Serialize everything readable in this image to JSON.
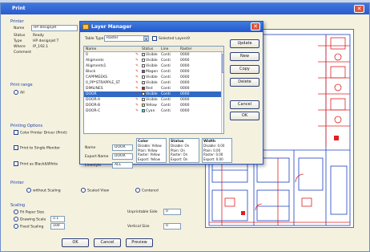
{
  "print_dialog": {
    "title": "Print",
    "close_glyph": "✕",
    "printer_group": "Printer",
    "printer_fields": [
      {
        "label": "Name",
        "value": "HP designjet"
      },
      {
        "label": "Status",
        "value": "Ready"
      },
      {
        "label": "Type",
        "value": "HP designjet T"
      },
      {
        "label": "Where",
        "value": "IP_192.1"
      },
      {
        "label": "Comment",
        "value": ""
      }
    ],
    "print_range_group": "Print range",
    "all_label": "All",
    "printing_options_group": "Printing Options",
    "print_options": [
      "Color Printer Driver (Print)",
      "Print to Single Monitor",
      "Print as Black&White"
    ],
    "printer_group_title": "Printer",
    "layout_options": [
      "without Scaling",
      "Scaled View",
      "Centered"
    ],
    "scaling_group": "Scaling",
    "scaling_options": [
      "Fit Paper Size",
      "Drawing Scale",
      "Fixed Scaling"
    ],
    "scaling_values": [
      "1:1",
      "100"
    ],
    "unprintable_label": "Unprintable Side",
    "vertical_label": "Vertical Size",
    "unprintable_value": "0",
    "vertical_value": "0",
    "buttons": {
      "ok": "OK",
      "cancel": "Cancel",
      "preview": "Preview"
    }
  },
  "layer_manager": {
    "title": "Layer Manager",
    "close_glyph": "✕",
    "table_type_label": "Table Type",
    "table_type_value": "Raster",
    "selected_layers_label": "Selected Layers",
    "selected_layers_value": "9",
    "columns": [
      "Name",
      "Status",
      "Line",
      "Raster"
    ],
    "rows": [
      {
        "name": "0",
        "vis": "Visible",
        "line": "Conti",
        "raster": "0000",
        "swatch": "#ffffff"
      },
      {
        "name": "Aligments",
        "vis": "Visible",
        "line": "Conti",
        "raster": "0000",
        "swatch": "#ffffff"
      },
      {
        "name": "Aligments1",
        "vis": "Visible",
        "line": "Conti",
        "raster": "0000",
        "swatch": "#ffffff"
      },
      {
        "name": "Block",
        "vis": "Magen",
        "line": "Conti",
        "raster": "0000",
        "swatch": "#ff00ff"
      },
      {
        "name": "CAPPMEEKS",
        "vis": "Visible",
        "line": "Conti",
        "raster": "0000",
        "swatch": "#ffffff"
      },
      {
        "name": "0_PP*STRAPPLE_ST",
        "vis": "Visible",
        "line": "Conti",
        "raster": "0000",
        "swatch": "#ffffff"
      },
      {
        "name": "DIMLINES",
        "vis": "Red",
        "line": "Conti",
        "raster": "0000",
        "swatch": "#ff0000"
      },
      {
        "name": "DOOR",
        "vis": "Visible",
        "line": "Conti",
        "raster": "0000",
        "swatch": "#ffffff",
        "selected": true
      },
      {
        "name": "DOOR-A",
        "vis": "Visible",
        "line": "Conti",
        "raster": "0000",
        "swatch": "#ffffff"
      },
      {
        "name": "DOOR-B",
        "vis": "Yellow",
        "line": "Conti",
        "raster": "0000",
        "swatch": "#ffff00"
      },
      {
        "name": "DOOR-C",
        "vis": "Cyan",
        "line": "Conti",
        "raster": "0000",
        "swatch": "#00ffff"
      }
    ],
    "side_buttons": [
      "Update",
      "New",
      "Copy",
      "Delete",
      "Cancel",
      "OK"
    ],
    "bottom_fields": [
      {
        "label": "Name",
        "value": "DOOR"
      },
      {
        "label": "Export Name",
        "value": "DOOR"
      },
      {
        "label": "Linestyle",
        "value": "ALL"
      }
    ],
    "color_col": {
      "title": "Color",
      "lines": [
        "Disable: Yellow",
        "Plain: Yellow",
        "Raster: Yellow",
        "Export: Yellow"
      ]
    },
    "status_col": {
      "title": "Status",
      "lines": [
        "Disable: On",
        "Plain: On",
        "Raster: On",
        "Export: On"
      ]
    },
    "width_col": {
      "title": "Width",
      "lines": [
        "Disable: 0.00",
        "Plain: 0.00",
        "Raster: 0.00",
        "Export: 0.00"
      ]
    }
  },
  "colors": {
    "accent": "#316ac5",
    "title_bar": "#2a5bd0",
    "dialog_bg": "#f4f1df",
    "cad_red": "#e02020",
    "cad_blue": "#1c3fc0"
  }
}
